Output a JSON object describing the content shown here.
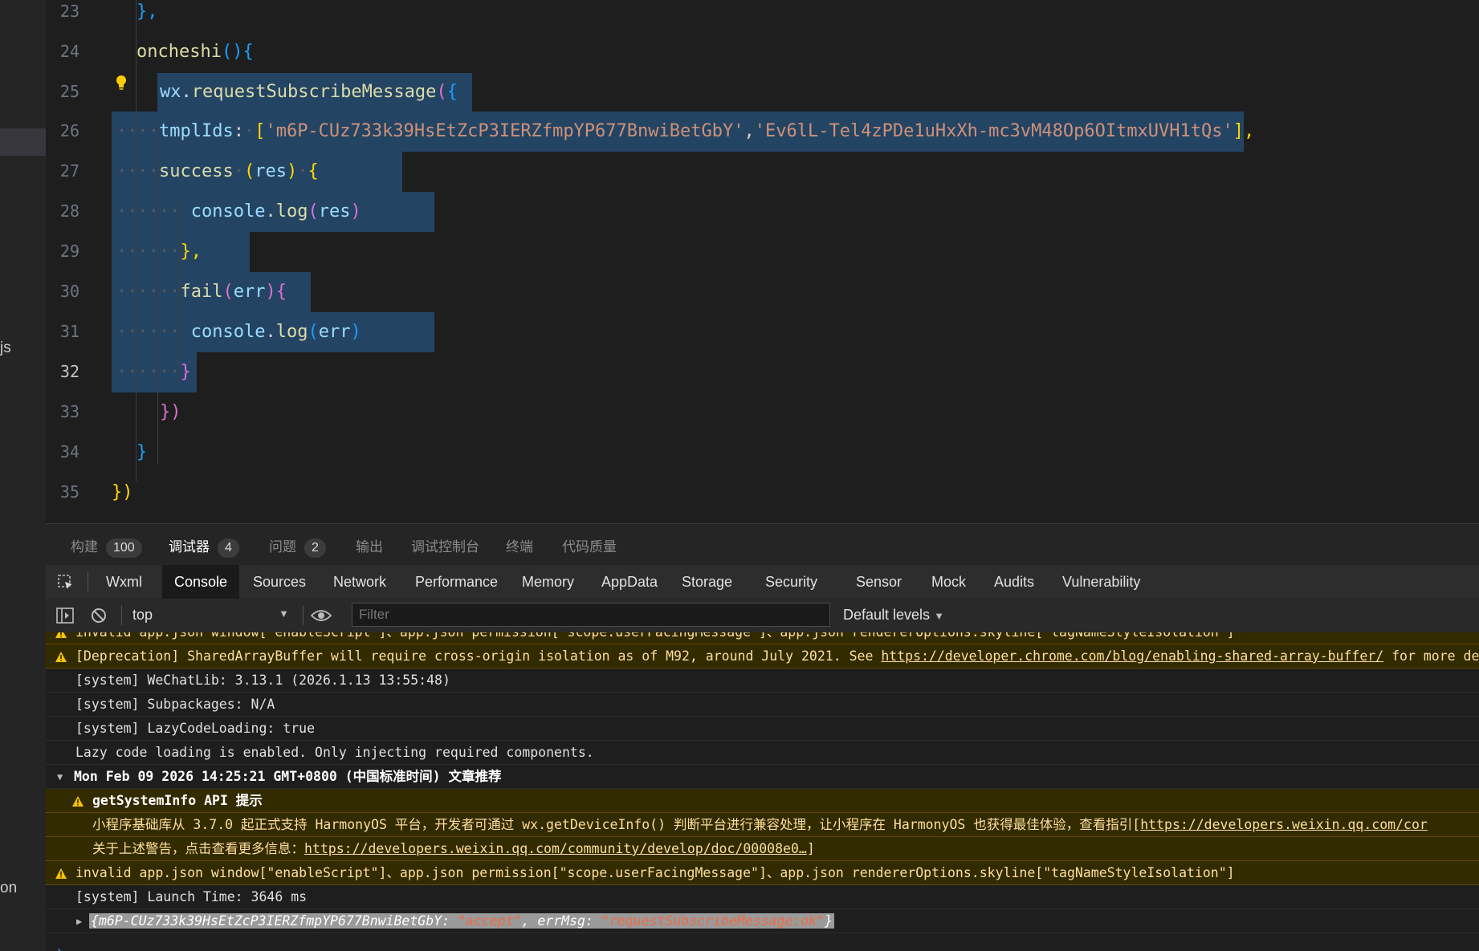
{
  "sidebar": {
    "fragments": [
      "js",
      "on"
    ]
  },
  "editor": {
    "line_numbers": [
      "23",
      "24",
      "25",
      "26",
      "27",
      "28",
      "29",
      "30",
      "31",
      "32",
      "33",
      "34",
      "35"
    ],
    "current_line": "32",
    "lines": {
      "l23": {
        "b": "},",
        "bc": "k-b3"
      },
      "l24": {
        "fn": "oncheshi",
        "paren": "()",
        "brace": "{"
      },
      "l25": {
        "obj": "wx",
        "dot": ".",
        "fn": "requestSubscribeMessage",
        "paren": "(",
        "brace": "{"
      },
      "l26": {
        "key": "tmplIds",
        "colon": ":",
        "open": "[",
        "s1": "'m6P-CUz733k39HsEtZcP3IERZfmpYP677BnwiBetGbY'",
        "comma": ",",
        "s2": "'Ev6lL-Tel4zPDe1uHxXh-mc3vM48Op6OItmxUVH1tQs'",
        "close": "],"
      },
      "l27": {
        "fn": "success",
        "paren_open": "(",
        "arg": "res",
        "paren_close": ")",
        "brace": "{"
      },
      "l28": {
        "obj": "console",
        "dot": ".",
        "fn": "log",
        "open": "(",
        "arg": "res",
        "close": ")"
      },
      "l29": {
        "b": "},",
        "comma": ""
      },
      "l30": {
        "fn": "fail",
        "open": "(",
        "arg": "err",
        "close": ")",
        "brace": "{"
      },
      "l31": {
        "obj": "console",
        "dot": ".",
        "fn": "log",
        "open": "(",
        "arg": "err",
        "close": ")"
      },
      "l32": {
        "b": "}"
      },
      "l33": {
        "b": "})"
      },
      "l34": {
        "b": "}"
      },
      "l35": {
        "b": "})"
      }
    }
  },
  "panel_tabs": [
    {
      "label": "构建",
      "badge": "100"
    },
    {
      "label": "调试器",
      "badge": "4"
    },
    {
      "label": "问题",
      "badge": "2"
    },
    {
      "label": "输出"
    },
    {
      "label": "调试控制台"
    },
    {
      "label": "终端"
    },
    {
      "label": "代码质量"
    }
  ],
  "devtools_tabs": [
    "Wxml",
    "Console",
    "Sources",
    "Network",
    "Performance",
    "Memory",
    "AppData",
    "Storage",
    "Security",
    "Sensor",
    "Mock",
    "Audits",
    "Vulnerability"
  ],
  "active_devtools_tab": "Console",
  "toolbar": {
    "context": "top",
    "filter_placeholder": "Filter",
    "levels": "Default levels"
  },
  "console": {
    "r0": "invalid app.json window[\"enableScript\"]、app.json permission[\"scope.userFacingMessage\"]、app.json rendererOptions.skyline[\"tagNameStyleIsolation\"]",
    "r1_text": "[Deprecation] SharedArrayBuffer will require cross-origin isolation as of M92, around July 2021. See ",
    "r1_url": "https://developer.chrome.com/blog/enabling-shared-array-buffer/",
    "r1_tail": " for more det",
    "r2": "[system] WeChatLib: 3.13.1 (2026.1.13 13:55:48)",
    "r3": "[system] Subpackages: N/A",
    "r4": "[system] LazyCodeLoading: true",
    "r5": "Lazy code loading is enabled. Only injecting required components.",
    "r6": "Mon Feb 09 2026 14:25:21 GMT+0800 (中国标准时间) 文章推荐",
    "r7": "getSystemInfo API 提示",
    "r8_text": "小程序基础库从 3.7.0 起正式支持 HarmonyOS 平台，开发者可通过 wx.getDeviceInfo() 判断平台进行兼容处理，让小程序在 HarmonyOS 也获得最佳体验，查看指引[",
    "r8_url": "https://developers.weixin.qq.com/cor",
    "r9_text": "关于上述警告，点击查看更多信息：",
    "r9_url": "https://developers.weixin.qq.com/community/develop/doc/00008e0…",
    "r9_tail": "]",
    "r10": "invalid app.json window[\"enableScript\"]、app.json permission[\"scope.userFacingMessage\"]、app.json rendererOptions.skyline[\"tagNameStyleIsolation\"]",
    "r11": "[system] Launch Time: 3646 ms",
    "r12": {
      "open": "{",
      "k1": "m6P-CUz733k39HsEtZcP3IERZfmpYP677BnwiBetGbY: ",
      "v1": "\"accept\"",
      "sep": ", ",
      "k2": "errMsg: ",
      "v2": "\"requestSubscribeMessage:ok\"",
      "close": "}"
    },
    "prompt": "›"
  },
  "colors": {
    "warning_bg": "#332b00",
    "selection": "#264f78",
    "accent": "#4d9fff"
  }
}
